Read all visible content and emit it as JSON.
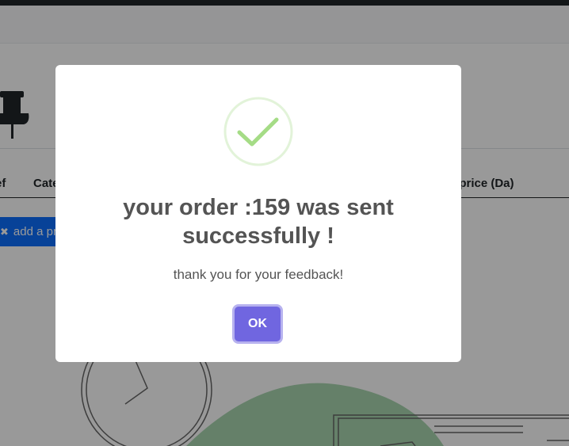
{
  "background": {
    "table_headers": [
      "ef",
      "Cate",
      "g price (Da)"
    ],
    "add_button_label": "add a pri",
    "icons": {
      "pin": "pin-icon",
      "add": "pin-icon"
    }
  },
  "modal": {
    "title": "your order :159 was sent successfully !",
    "text": "thank you for your feedback!",
    "ok_label": "OK",
    "icon": "success-check-icon"
  },
  "colors": {
    "primary": "#0d6efd",
    "confirm_button": "#7066e0",
    "success": "#a5dc86",
    "text": "#545454"
  }
}
